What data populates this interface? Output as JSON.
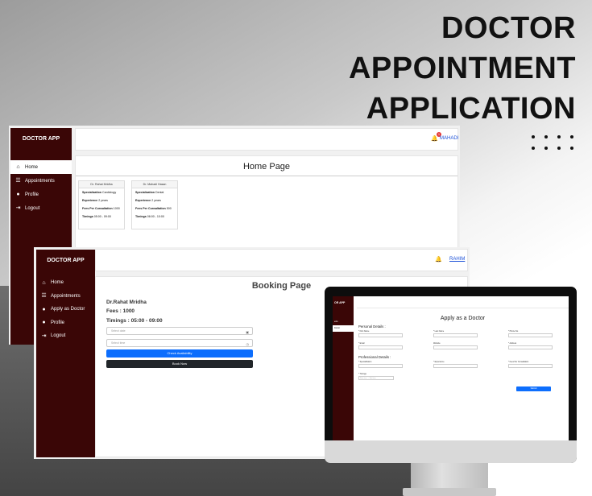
{
  "poster": {
    "title_line1": "DOCTOR",
    "title_line2": "APPOINTMENT",
    "title_line3": "APPLICATION"
  },
  "home_window": {
    "brand": "DOCTOR APP",
    "nav": [
      {
        "label": "Home",
        "icon": "home-icon"
      },
      {
        "label": "Appointments",
        "icon": "list-icon"
      },
      {
        "label": "Profile",
        "icon": "user-icon"
      },
      {
        "label": "Logout",
        "icon": "logout-icon"
      }
    ],
    "notification_count": "1",
    "user_name": "MAHADI",
    "page_title": "Home Page",
    "doctors": [
      {
        "name": "Dr. Rahat Mridha",
        "specialization_label": "Specialization",
        "specialization": "Cardiology",
        "experience_label": "Experience",
        "experience": "2 years",
        "fees_label": "Fees Per Cunsaltation",
        "fees": "1000",
        "timings_label": "Timings",
        "timings": "05:00 - 09:00"
      },
      {
        "name": "Dr. Mahadi Hasan",
        "specialization_label": "Specialization",
        "specialization": "Dental",
        "experience_label": "Experience",
        "experience": "2 years",
        "fees_label": "Fees Per Cunsaltation",
        "fees": "500",
        "timings_label": "Timings",
        "timings": "06:00 - 10:00"
      }
    ]
  },
  "booking_window": {
    "brand": "DOCTOR APP",
    "nav": [
      {
        "label": "Home",
        "icon": "home-icon"
      },
      {
        "label": "Appointments",
        "icon": "list-icon"
      },
      {
        "label": "Apply as Doctor",
        "icon": "user-plus-icon"
      },
      {
        "label": "Profile",
        "icon": "user-icon"
      },
      {
        "label": "Logout",
        "icon": "logout-icon"
      }
    ],
    "user_name": "RAHIM",
    "page_title": "Booking Page",
    "doctor_name": "Dr.Rahat Mridha",
    "fees_text": "Fees : 1000",
    "timings_text": "Timings : 05:00 - 09:00",
    "date_placeholder": "Select date",
    "time_placeholder": "Select time",
    "check_button": "Check Availability",
    "book_button": "Book Now",
    "colors": {
      "primary": "#0d6efd",
      "dark": "#212529",
      "sidebar": "#3a0606"
    }
  },
  "apply_window": {
    "brand": "OR APP",
    "nav": [
      "ents",
      "Doctor"
    ],
    "page_title": "Apply as a Doctor",
    "personal_section": "Personal Details :",
    "professional_section": "Professional Details :",
    "personal_fields": [
      "* First Name",
      "* Last Name",
      "* Phone No",
      "* Email",
      "Website",
      "* Address"
    ],
    "professional_fields": [
      "* Specialization",
      "* Experience",
      "* Fees Per Cunsaltation"
    ],
    "timings_label": "* Timings",
    "timings_start": "Start time",
    "timings_end": "End time",
    "submit": "Submit"
  }
}
